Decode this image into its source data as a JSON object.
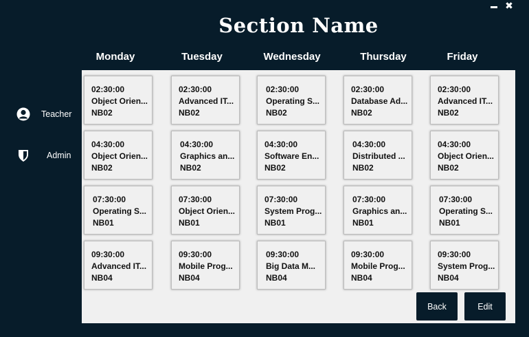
{
  "window": {
    "minimize_label": "",
    "close_label": "✖"
  },
  "header": {
    "title": "Section Name"
  },
  "sidebar": {
    "items": [
      {
        "label": "Teacher",
        "icon": "user-icon"
      },
      {
        "label": "Admin",
        "icon": "shield-icon"
      }
    ]
  },
  "days": [
    "Monday",
    "Tuesday",
    "Wednesday",
    "Thursday",
    "Friday"
  ],
  "schedule": [
    [
      {
        "time": "02:30:00",
        "course": "Object Orien...",
        "room": "NB02"
      },
      {
        "time": "04:30:00",
        "course": "Object Orien...",
        "room": "NB02"
      },
      {
        "time": "07:30:00",
        "course": "Operating S...",
        "room": "NB01"
      },
      {
        "time": "09:30:00",
        "course": "Advanced IT...",
        "room": "NB04"
      }
    ],
    [
      {
        "time": "02:30:00",
        "course": "Advanced IT...",
        "room": "NB02"
      },
      {
        "time": "04:30:00",
        "course": "Graphics an...",
        "room": "NB02"
      },
      {
        "time": "07:30:00",
        "course": "Object Orien...",
        "room": "NB01"
      },
      {
        "time": "09:30:00",
        "course": "Mobile Prog...",
        "room": "NB04"
      }
    ],
    [
      {
        "time": "02:30:00",
        "course": "Operating S...",
        "room": "NB02"
      },
      {
        "time": "04:30:00",
        "course": "Software En...",
        "room": "NB02"
      },
      {
        "time": "07:30:00",
        "course": "System Prog...",
        "room": "NB01"
      },
      {
        "time": "09:30:00",
        "course": "Big Data M...",
        "room": "NB04"
      }
    ],
    [
      {
        "time": "02:30:00",
        "course": "Database Ad...",
        "room": "NB02"
      },
      {
        "time": "04:30:00",
        "course": "Distributed ...",
        "room": "NB02"
      },
      {
        "time": "07:30:00",
        "course": "Graphics an...",
        "room": "NB01"
      },
      {
        "time": "09:30:00",
        "course": "Mobile Prog...",
        "room": "NB04"
      }
    ],
    [
      {
        "time": "02:30:00",
        "course": "Advanced IT...",
        "room": "NB02"
      },
      {
        "time": "04:30:00",
        "course": "Object Orien...",
        "room": "NB02"
      },
      {
        "time": "07:30:00",
        "course": "Operating S...",
        "room": "NB01"
      },
      {
        "time": "09:30:00",
        "course": "System Prog...",
        "room": "NB04"
      }
    ]
  ],
  "actions": {
    "back_label": "Back",
    "edit_label": "Edit"
  },
  "colors": {
    "dark": "#071c2a",
    "panel": "#f0f0f0"
  }
}
